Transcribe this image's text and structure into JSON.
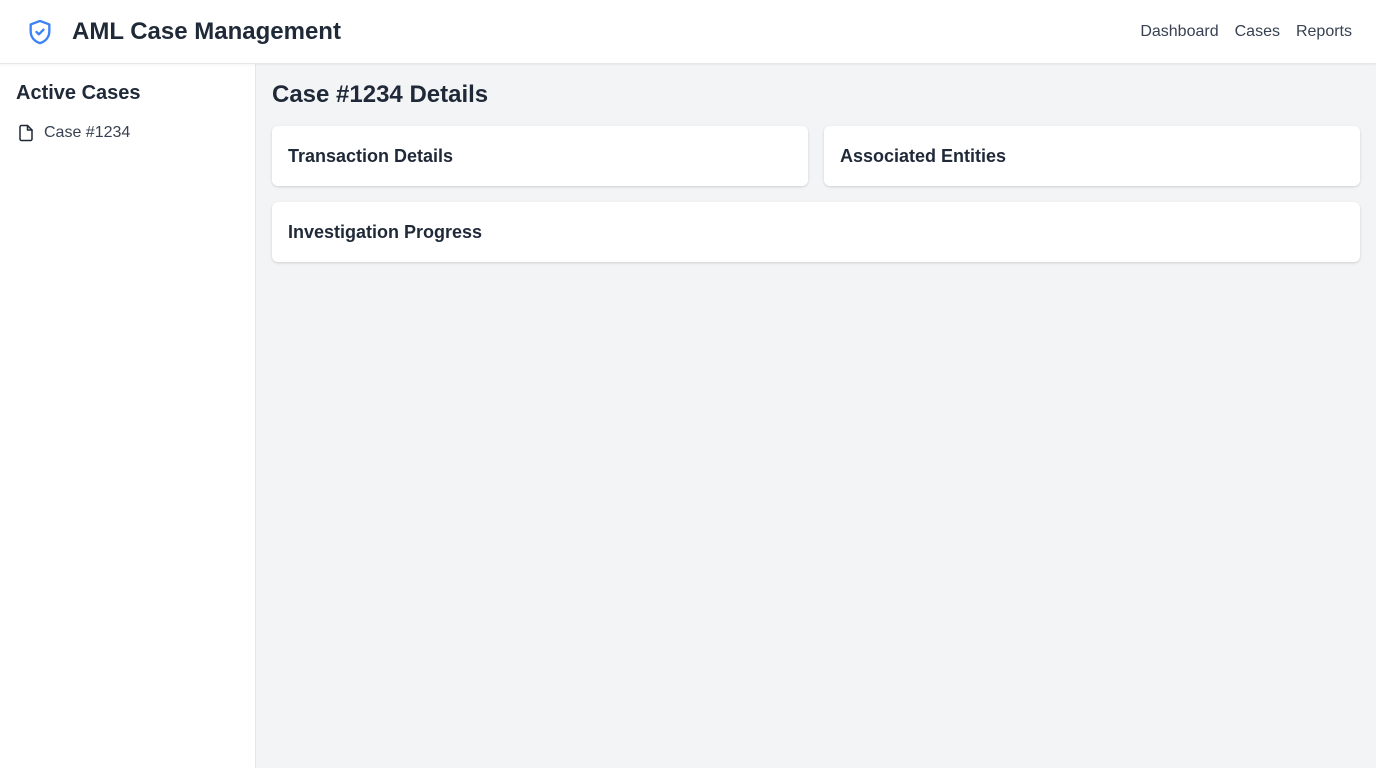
{
  "app": {
    "title": "AML Case Management",
    "brand_icon": "shield-check-icon",
    "accent_color": "#3b82f6"
  },
  "nav": {
    "links": [
      {
        "label": "Dashboard"
      },
      {
        "label": "Cases"
      },
      {
        "label": "Reports"
      }
    ]
  },
  "sidebar": {
    "title": "Active Cases",
    "items": [
      {
        "label": "Case #1234",
        "icon": "file-icon"
      }
    ]
  },
  "main": {
    "title": "Case #1234 Details",
    "cards": [
      {
        "title": "Transaction Details"
      },
      {
        "title": "Associated Entities"
      },
      {
        "title": "Investigation Progress"
      }
    ]
  }
}
